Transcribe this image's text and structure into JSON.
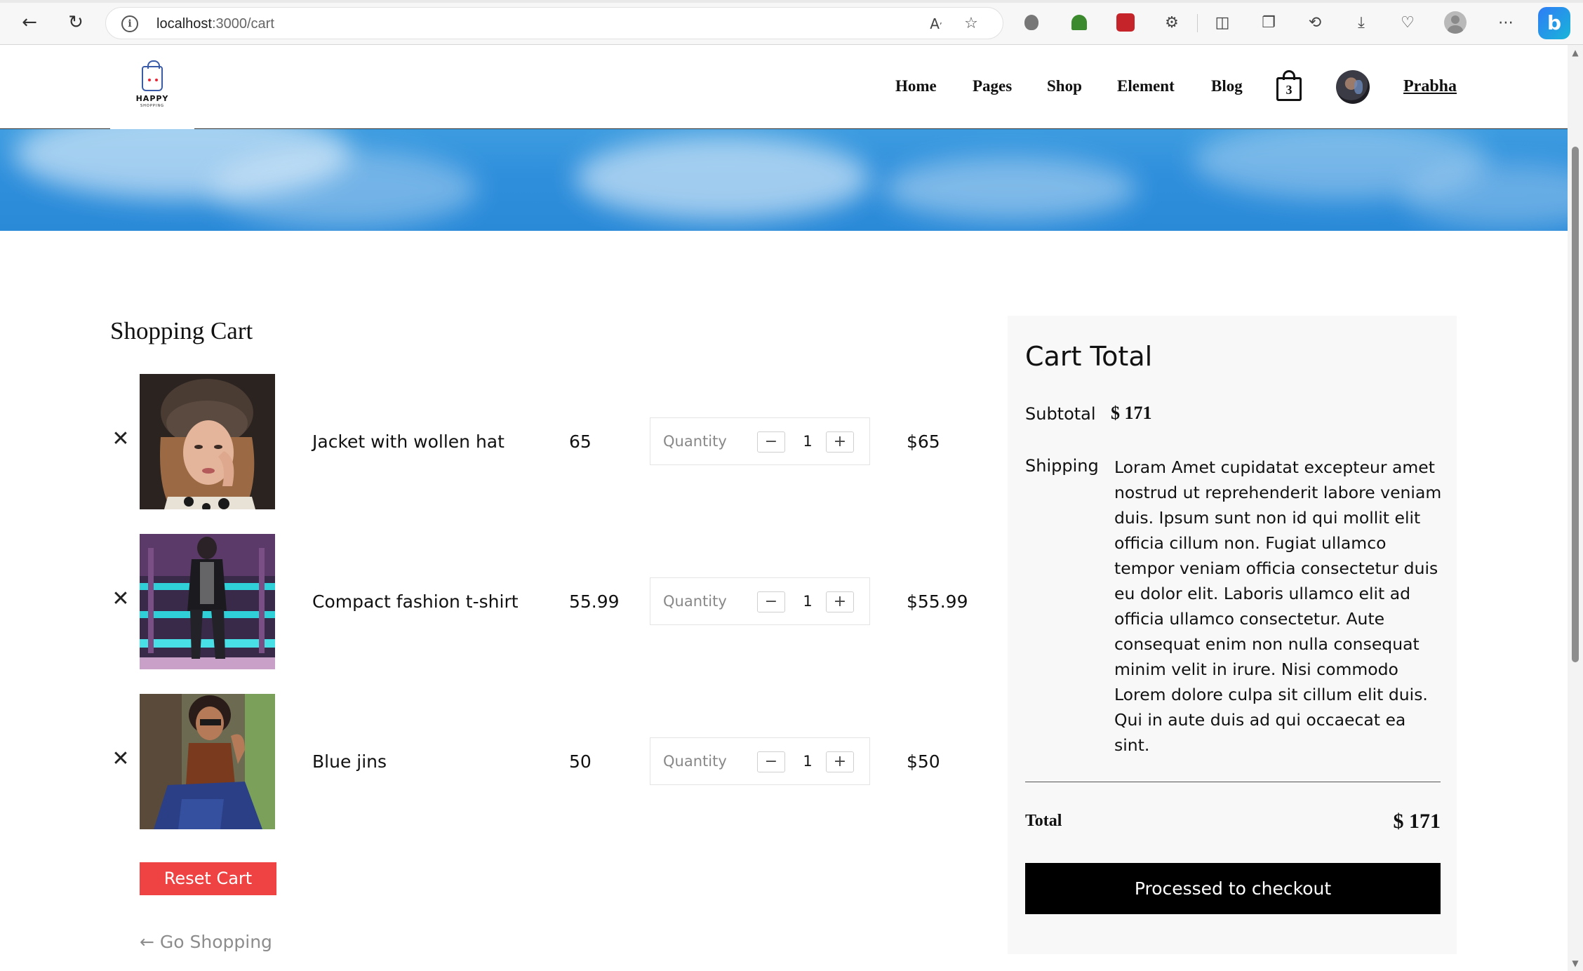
{
  "browser": {
    "url_host": "localhost",
    "url_path": ":3000/cart",
    "icons": [
      "back-icon",
      "refresh-icon",
      "info-icon",
      "read-aloud-icon",
      "favorite-star-icon",
      "bug-extension-icon",
      "html-tree-extension-icon",
      "red-extension-icon",
      "extensions-icon",
      "split-screen-icon",
      "collections-icon",
      "history-icon",
      "downloads-icon",
      "performance-icon",
      "profile-icon",
      "more-icon",
      "bing-icon"
    ]
  },
  "header": {
    "logo_text": "HAPPY",
    "logo_tagline": "SHOPPING",
    "nav": [
      "Home",
      "Pages",
      "Shop",
      "Element",
      "Blog"
    ],
    "cart_count": "3",
    "username": "Prabha"
  },
  "cart": {
    "title": "Shopping Cart",
    "items": [
      {
        "name": "Jacket with wollen hat",
        "price": "65",
        "quantity_label": "Quantity",
        "quantity": "1",
        "total": "$65"
      },
      {
        "name": "Compact fashion t-shirt",
        "price": "55.99",
        "quantity_label": "Quantity",
        "quantity": "1",
        "total": "$55.99"
      },
      {
        "name": "Blue jins",
        "price": "50",
        "quantity_label": "Quantity",
        "quantity": "1",
        "total": "$50"
      }
    ],
    "reset_label": "Reset Cart",
    "go_shopping_label": "← Go Shopping",
    "remove_symbol": "✕",
    "minus_symbol": "−",
    "plus_symbol": "+"
  },
  "summary": {
    "title": "Cart Total",
    "subtotal_label": "Subtotal",
    "subtotal_value": "$ 171",
    "shipping_label": "Shipping",
    "shipping_text": "Loram Amet cupidatat excepteur amet nostrud ut reprehenderit labore veniam duis. Ipsum sunt non id qui mollit elit officia cillum non. Fugiat ullamco tempor veniam officia consectetur duis eu dolor elit. Laboris ullamco elit ad officia ullamco consectetur. Aute consequat enim non nulla consequat minim velit in irure. Nisi commodo Lorem dolore culpa sit cillum elit duis. Qui in aute duis ad qui occaecat ea sint.",
    "total_label": "Total",
    "total_value": "$ 171",
    "checkout_label": "Processed to checkout"
  },
  "colors": {
    "reset_button": "#ef4343",
    "checkout_button": "#000000",
    "banner_sky": "#2f8fdc"
  }
}
